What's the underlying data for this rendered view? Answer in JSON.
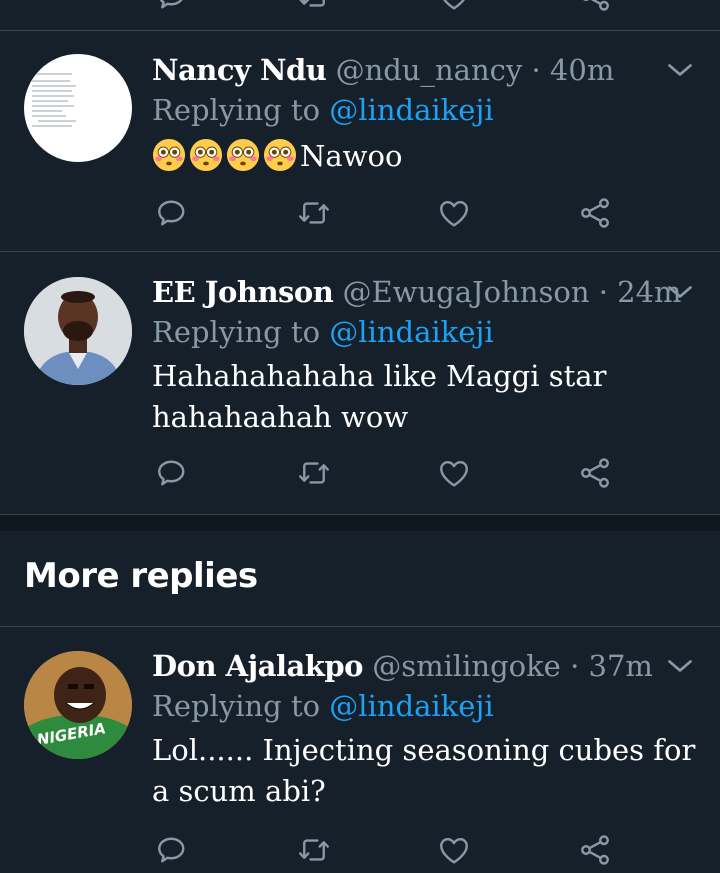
{
  "colors": {
    "background": "#15202b",
    "divider": "#38444d",
    "muted": "#8899a6",
    "accent": "#1da1f2",
    "emoji": "#ffcc4d"
  },
  "icons": {
    "reply": "reply-icon",
    "retweet": "retweet-icon",
    "like": "like-icon",
    "share": "share-icon",
    "menu": "chevron-down-icon"
  },
  "tweets": [
    {
      "name": "Nancy Ndu",
      "handle": "@ndu_nancy",
      "time": "· 40m",
      "replying_label": "Replying to",
      "replying_to": "@lindaikeji",
      "emoji": "😳😳😳😳",
      "text": "Nawoo"
    },
    {
      "name": "EE Johnson",
      "handle": "@EwugaJohnson",
      "time": "· 24m",
      "replying_label": "Replying to",
      "replying_to": "@lindaikeji",
      "text": "Hahahahahaha like Maggi star hahahaahah wow"
    },
    {
      "name": "Don Ajalakpo",
      "handle": "@smilingoke",
      "time": "· 37m",
      "replying_label": "Replying to",
      "replying_to": "@lindaikeji",
      "text": "Lol...... Injecting seasoning cubes for a scum abi?"
    }
  ],
  "more_replies_label": "More replies",
  "avatar_text": {
    "shirt_text": "NIGERIA"
  }
}
